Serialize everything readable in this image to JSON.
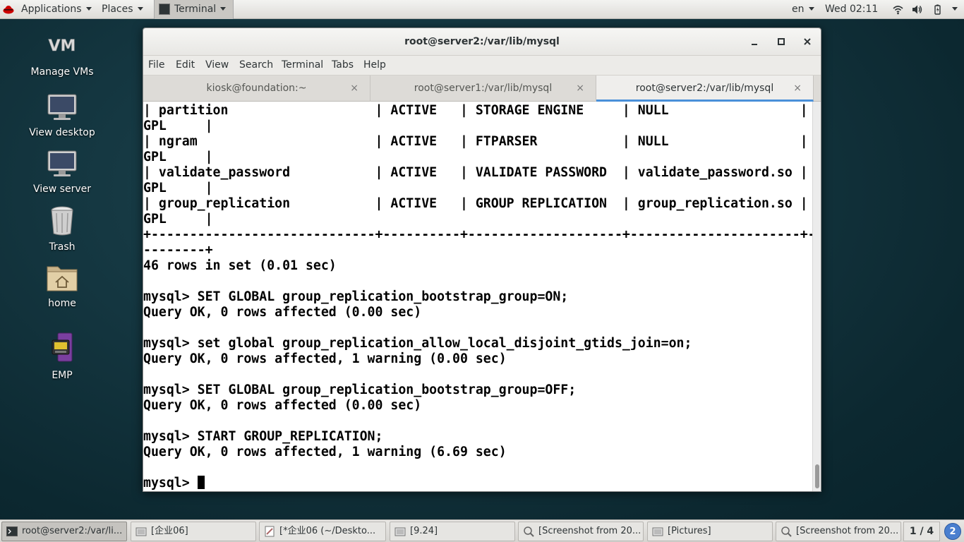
{
  "topbar": {
    "applications": "Applications",
    "places": "Places",
    "terminal": "Terminal",
    "lang": "en",
    "clock": "Wed 02:11"
  },
  "desktop": [
    {
      "label": "Manage VMs",
      "icon": "vm-icon"
    },
    {
      "label": "View desktop",
      "icon": "monitor-icon"
    },
    {
      "label": "View server",
      "icon": "monitor-icon"
    },
    {
      "label": "Trash",
      "icon": "trash-icon"
    },
    {
      "label": "home",
      "icon": "home-folder-icon"
    },
    {
      "label": "EMP",
      "icon": "emp-icon"
    }
  ],
  "window": {
    "title": "root@server2:/var/lib/mysql",
    "menu": [
      "File",
      "Edit",
      "View",
      "Search",
      "Terminal",
      "Tabs",
      "Help"
    ],
    "tabs": [
      {
        "label": "kiosk@foundation:~",
        "active": false
      },
      {
        "label": "root@server1:/var/lib/mysql",
        "active": false
      },
      {
        "label": "root@server2:/var/lib/mysql",
        "active": true
      }
    ]
  },
  "terminal": {
    "lines": [
      "| partition                   | ACTIVE   | STORAGE ENGINE     | NULL                 |",
      "GPL     |",
      "| ngram                       | ACTIVE   | FTPARSER           | NULL                 |",
      "GPL     |",
      "| validate_password           | ACTIVE   | VALIDATE PASSWORD  | validate_password.so |",
      "GPL     |",
      "| group_replication           | ACTIVE   | GROUP REPLICATION  | group_replication.so |",
      "GPL     |",
      "+-----------------------------+----------+--------------------+----------------------+-",
      "--------+",
      "46 rows in set (0.01 sec)",
      "",
      "mysql> SET GLOBAL group_replication_bootstrap_group=ON;",
      "Query OK, 0 rows affected (0.00 sec)",
      "",
      "mysql> set global group_replication_allow_local_disjoint_gtids_join=on;",
      "Query OK, 0 rows affected, 1 warning (0.00 sec)",
      "",
      "mysql> SET GLOBAL group_replication_bootstrap_group=OFF;",
      "Query OK, 0 rows affected (0.00 sec)",
      "",
      "mysql> START GROUP_REPLICATION;",
      "Query OK, 0 rows affected, 1 warning (6.69 sec)",
      ""
    ],
    "prompt": "mysql> "
  },
  "taskbar": {
    "tasks": [
      {
        "label": "root@server2:/var/li...",
        "active": true,
        "icon": "terminal-icon"
      },
      {
        "label": "[企业06]",
        "active": false,
        "icon": "file-manager-icon"
      },
      {
        "label": "[*企业06 (~/Deskto...",
        "active": false,
        "icon": "text-editor-icon"
      },
      {
        "label": "[9.24]",
        "active": false,
        "icon": "file-manager-icon"
      },
      {
        "label": "[Screenshot from 20...",
        "active": false,
        "icon": "image-viewer-icon"
      },
      {
        "label": "[Pictures]",
        "active": false,
        "icon": "file-manager-icon"
      },
      {
        "label": "[Screenshot from 20...",
        "active": false,
        "icon": "image-viewer-icon"
      }
    ],
    "workspace": "1 / 4",
    "notification_count": "2"
  }
}
